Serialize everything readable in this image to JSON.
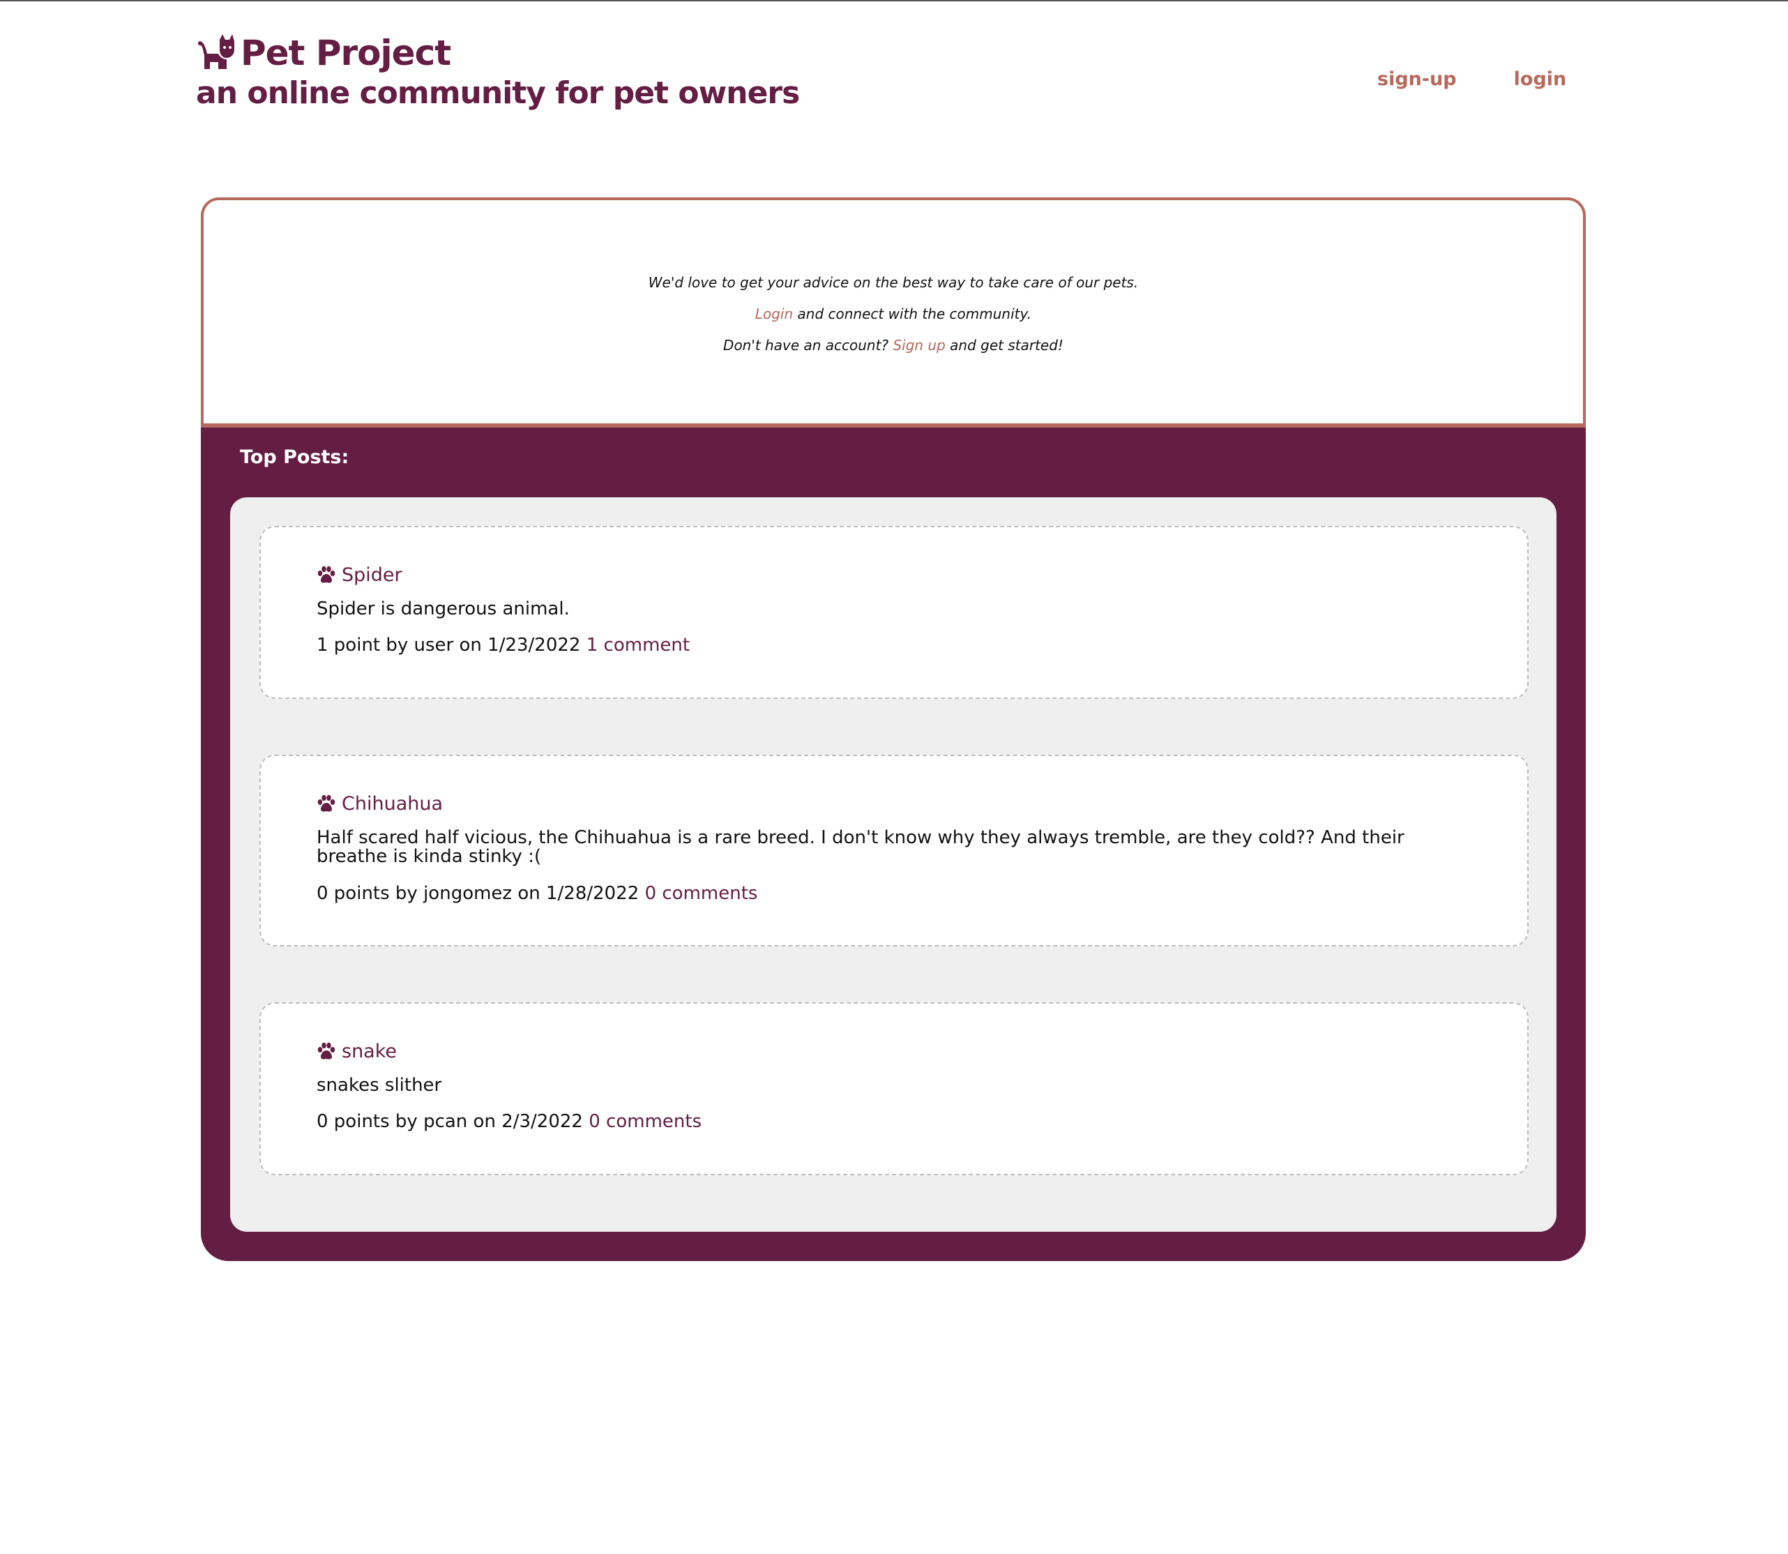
{
  "site": {
    "title": "Pet Project",
    "tagline": "an online community for pet owners",
    "logo_icon": "cat-icon"
  },
  "nav": {
    "signup_label": "sign-up",
    "login_label": "login"
  },
  "welcome": {
    "line1": "We'd love to get your advice on the best way to take care of our pets.",
    "line2_link": "Login",
    "line2_text": " and connect with the community.",
    "line3_prefix": "Don't have an account? ",
    "line3_link": "Sign up",
    "line3_suffix": " and get started!"
  },
  "top_posts": {
    "heading": "Top Posts:",
    "post_icon": "paw-icon",
    "posts": [
      {
        "title": "Spider",
        "body": "Spider is dangerous animal.",
        "meta": "1 point by user on 1/23/2022",
        "comments": "1 comment"
      },
      {
        "title": "Chihuahua",
        "body": "Half scared half vicious, the Chihuahua is a rare breed. I don't know why they always tremble, are they cold?? And their breathe is kinda stinky :(",
        "meta": "0 points by jongomez on 1/28/2022",
        "comments": "0 comments"
      },
      {
        "title": "snake",
        "body": "snakes slither",
        "meta": "0 points by pcan on 2/3/2022",
        "comments": "0 comments"
      }
    ]
  },
  "colors": {
    "brand": "#641d43",
    "accent": "#b6695c",
    "panel_background": "#efefef"
  }
}
